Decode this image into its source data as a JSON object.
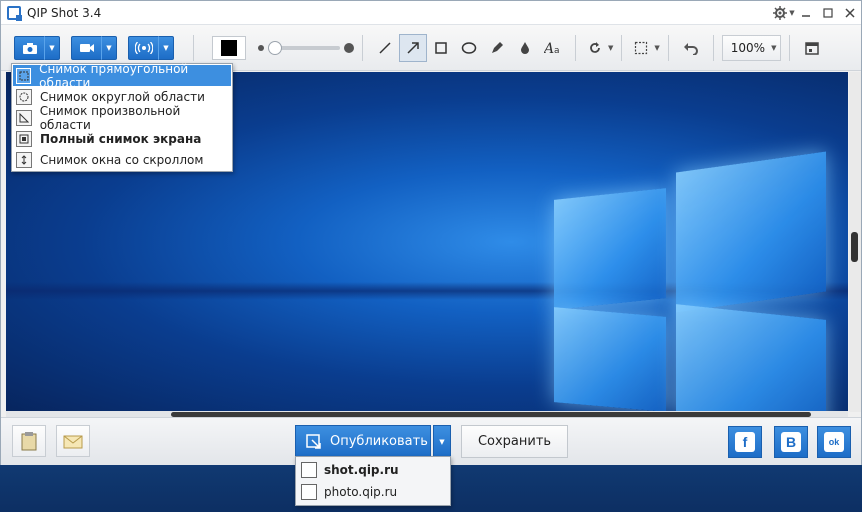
{
  "window": {
    "title": "QIP Shot 3.4"
  },
  "toolbar": {
    "zoom": "100%",
    "color": "#000000"
  },
  "capture_menu": {
    "items": [
      {
        "label": "Снимок прямоугольной области",
        "icon": "rect-area-icon",
        "selected": true
      },
      {
        "label": "Снимок округлой области",
        "icon": "round-area-icon",
        "selected": false
      },
      {
        "label": "Снимок произвольной области",
        "icon": "freeform-area-icon",
        "selected": false
      },
      {
        "label": "Полный снимок экрана",
        "icon": "fullscreen-icon",
        "selected": false,
        "bold": true
      },
      {
        "label": "Снимок окна со скроллом",
        "icon": "scroll-window-icon",
        "selected": false
      }
    ]
  },
  "bottombar": {
    "publish_label": "Опубликовать",
    "save_label": "Сохранить"
  },
  "publish_menu": {
    "items": [
      {
        "label": "shot.qip.ru",
        "bold": true
      },
      {
        "label": "photo.qip.ru",
        "bold": false
      }
    ]
  },
  "social": {
    "facebook": "f",
    "vkontakte": "B",
    "odnoklassniki": "ok"
  },
  "colors": {
    "accent": "#1d6dc7",
    "selection": "#3d8fe0"
  }
}
